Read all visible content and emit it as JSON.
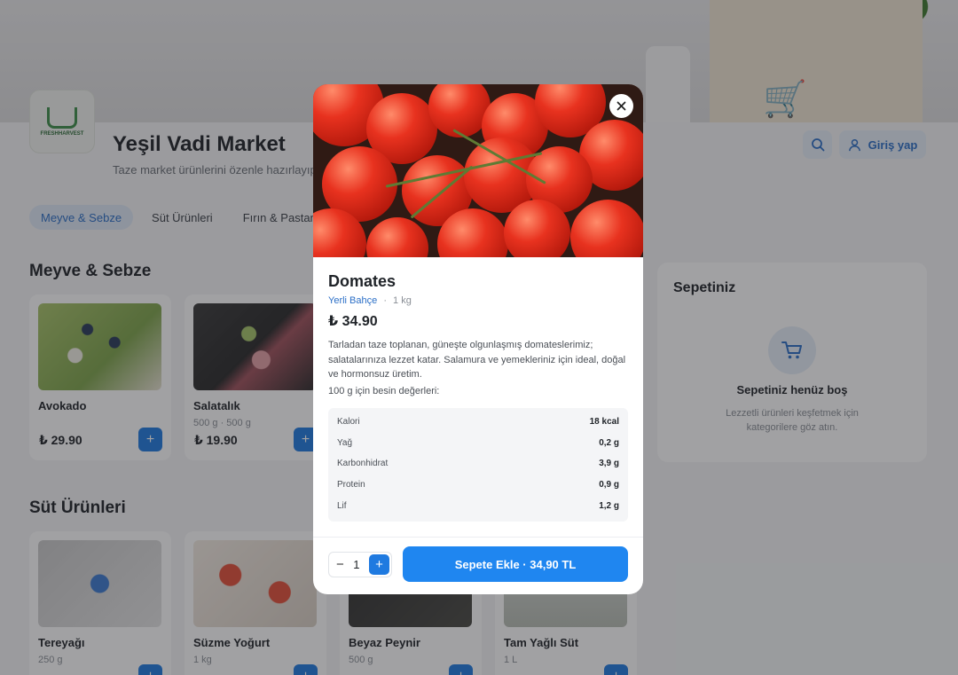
{
  "store": {
    "name": "Yeşil Vadi Market",
    "subtitle": "Taze market ürünlerini özenle hazırlayıp adresinize getiriyoruz.",
    "logo_text": "FRESHHARVEST"
  },
  "header": {
    "login_label": "Giriş yap"
  },
  "tabs": [
    {
      "label": "Meyve & Sebze",
      "active": true
    },
    {
      "label": "Süt Ürünleri",
      "active": false
    },
    {
      "label": "Fırın & Pastane",
      "active": false
    }
  ],
  "sections": {
    "produce": {
      "title": "Meyve & Sebze",
      "items": [
        {
          "name": "Avokado",
          "unit": "",
          "price": "₺ 29.90"
        },
        {
          "name": "Salatalık",
          "unit": "500 g · 500 g",
          "price": "₺ 19.90"
        }
      ]
    },
    "dairy": {
      "title": "Süt Ürünleri",
      "items": [
        {
          "name": "Tereyağı",
          "unit": "250 g"
        },
        {
          "name": "Süzme Yoğurt",
          "unit": "1 kg"
        },
        {
          "name": "Beyaz Peynir",
          "unit": "500 g"
        },
        {
          "name": "Tam Yağlı Süt",
          "unit": "1 L"
        }
      ]
    }
  },
  "cart": {
    "title": "Sepetiniz",
    "empty_title": "Sepetiniz henüz boş",
    "empty_hint": "Lezzetli ürünleri keşfetmek için kategorilere göz atın."
  },
  "modal": {
    "name": "Domates",
    "brand": "Yerli Bahçe",
    "separator": "·",
    "unit": "1 kg",
    "price": "₺ 34.90",
    "description": "Tarladan taze toplanan, güneşte olgunlaşmış domateslerimiz; salatalarınıza lezzet katar. Salamura ve yemekleriniz için ideal, doğal ve hormonsuz üretim.",
    "nutrition_title": "100 g için besin değerleri:",
    "nutrition": [
      {
        "label": "Kalori",
        "value": "18 kcal"
      },
      {
        "label": "Yağ",
        "value": "0,2 g"
      },
      {
        "label": "Karbonhidrat",
        "value": "3,9 g"
      },
      {
        "label": "Protein",
        "value": "0,9 g"
      },
      {
        "label": "Lif",
        "value": "1,2 g"
      }
    ],
    "quantity": "1",
    "add_to_cart_label": "Sepete Ekle · 34,90 TL"
  },
  "icons": {
    "close": "close-icon",
    "search": "search-icon",
    "user": "user-icon",
    "cart": "cart-icon",
    "plus": "plus-icon",
    "minus": "minus-icon"
  },
  "colors": {
    "accent": "#1f86f0",
    "accent_soft": "#e6eef8",
    "text": "#1f2328"
  }
}
